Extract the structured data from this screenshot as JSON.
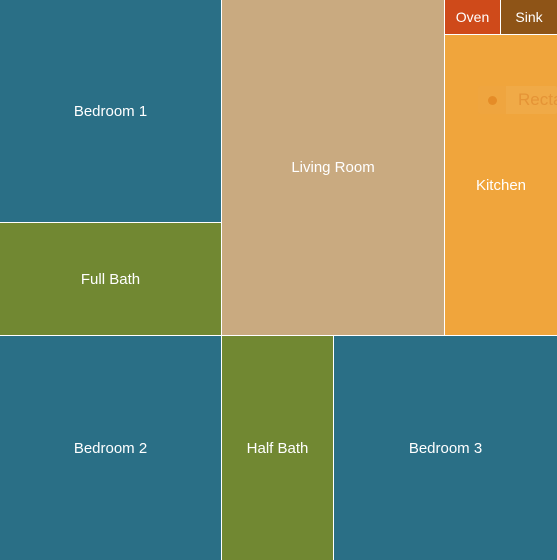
{
  "colors": {
    "bedroom": "#2a6f86",
    "bath": "#718832",
    "living": "#c9aa80",
    "kitchen": "#f0a53c",
    "oven": "#cf4a1a",
    "sink": "#8e5417",
    "label": "#ffffff"
  },
  "rooms": [
    {
      "id": "bedroom-1",
      "label": "Bedroom 1",
      "color_key": "bedroom"
    },
    {
      "id": "full-bath",
      "label": "Full Bath",
      "color_key": "bath"
    },
    {
      "id": "living-room",
      "label": "Living Room",
      "color_key": "living"
    },
    {
      "id": "kitchen",
      "label": "Kitchen",
      "color_key": "kitchen"
    },
    {
      "id": "oven",
      "label": "Oven",
      "color_key": "oven"
    },
    {
      "id": "sink",
      "label": "Sink",
      "color_key": "sink"
    },
    {
      "id": "bedroom-2",
      "label": "Bedroom 2",
      "color_key": "bedroom"
    },
    {
      "id": "half-bath",
      "label": "Half Bath",
      "color_key": "bath"
    },
    {
      "id": "bedroom-3",
      "label": "Bedroom 3",
      "color_key": "bedroom"
    }
  ],
  "ghost_legend": {
    "text": "Recta"
  }
}
